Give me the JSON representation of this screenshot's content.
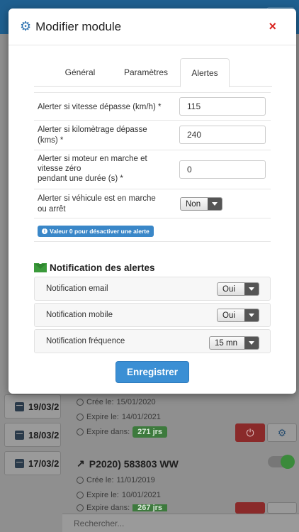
{
  "background": {
    "dates": [
      "19/03/2",
      "18/03/2",
      "17/03/2"
    ],
    "card1": {
      "created_label": "Crée le:",
      "created": "15/01/2020",
      "expires_label": "Expire le:",
      "expires": "14/01/2021",
      "remaining_label": "Expire dans:",
      "remaining": "271 jrs"
    },
    "card2": {
      "title": "P2020) 583803 WW",
      "created_label": "Crée le:",
      "created": "11/01/2019",
      "expires_label": "Expire le:",
      "expires": "10/01/2021",
      "remaining_label": "Expire dans:",
      "remaining": "267 jrs"
    },
    "search_placeholder": "Rechercher..."
  },
  "modal": {
    "title": "Modifier module",
    "close_label": "×",
    "tabs": [
      {
        "label": "Général"
      },
      {
        "label": "Paramètres"
      },
      {
        "label": "Alertes"
      }
    ],
    "alerts": {
      "speed_label": "Alerter si vitesse dépasse (km/h) *",
      "speed_value": "115",
      "km_label_1": "Alerter si kilomètrage dépasse",
      "km_label_2": "(kms) *",
      "km_value": "240",
      "idle_label_1": "Alerter si moteur en marche et",
      "idle_label_2": "vitesse zéro",
      "idle_label_3": "pendant une durée (s) *",
      "idle_value": "0",
      "moving_label_1": "Alerter si véhicule est en marche",
      "moving_label_2": "ou arrêt",
      "moving_value": "Non",
      "info_text": "Valeur 0 pour désactiver une alerte"
    },
    "notifications": {
      "title": "Notification des alertes",
      "email_label": "Notification email",
      "email_value": "Oui",
      "mobile_label": "Notification mobile",
      "mobile_value": "Oui",
      "freq_label": "Notification fréquence",
      "freq_value": "15 mn"
    },
    "save_label": "Enregistrer"
  },
  "colors": {
    "accent": "#3b8fd4",
    "close": "#d9241f",
    "info": "#3a87c8",
    "envelope": "#3b9a3b"
  }
}
